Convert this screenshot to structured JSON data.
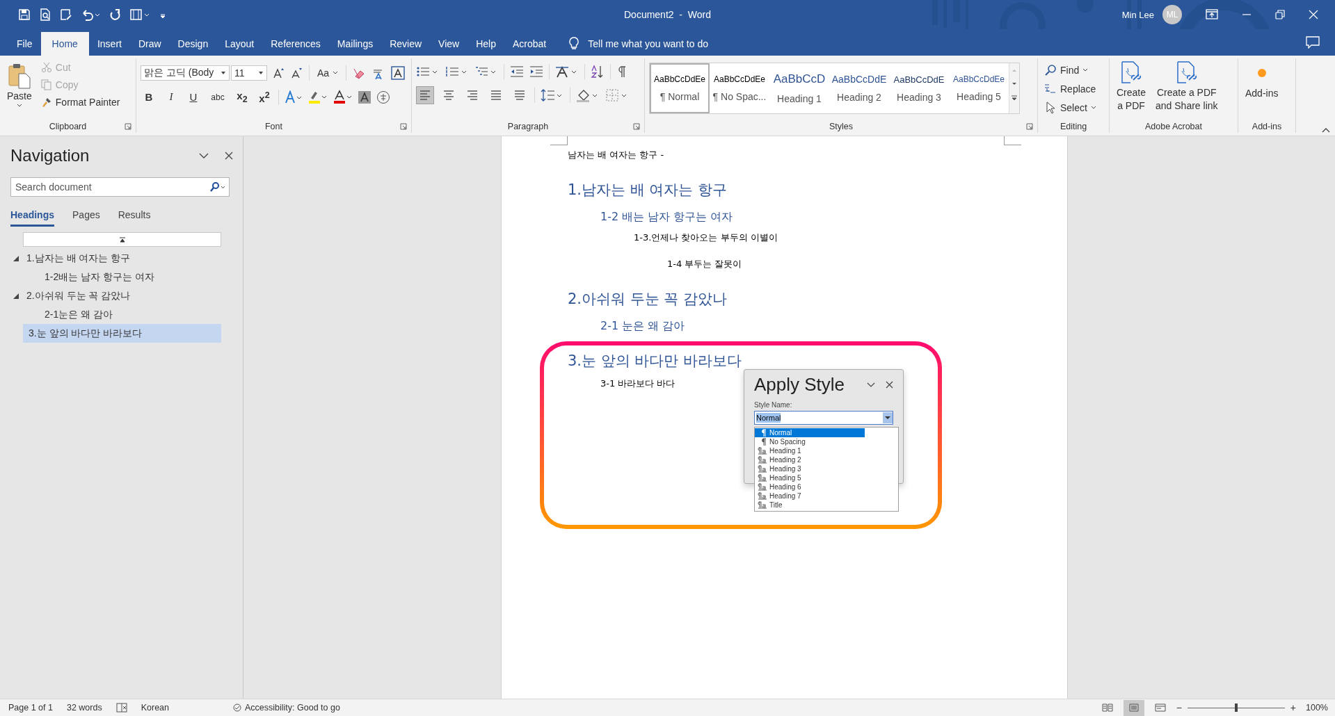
{
  "window": {
    "title": "Document2  -  Word",
    "user": "Min Lee",
    "avatar": "ML"
  },
  "tabs": [
    {
      "label": "File",
      "selected": false
    },
    {
      "label": "Home",
      "selected": true
    },
    {
      "label": "Insert",
      "selected": false
    },
    {
      "label": "Draw",
      "selected": false
    },
    {
      "label": "Design",
      "selected": false
    },
    {
      "label": "Layout",
      "selected": false
    },
    {
      "label": "References",
      "selected": false
    },
    {
      "label": "Mailings",
      "selected": false
    },
    {
      "label": "Review",
      "selected": false
    },
    {
      "label": "View",
      "selected": false
    },
    {
      "label": "Help",
      "selected": false
    },
    {
      "label": "Acrobat",
      "selected": false
    }
  ],
  "tell_me": {
    "placeholder": "Tell me what you want to do"
  },
  "ribbon": {
    "clipboard": {
      "label": "Clipboard",
      "paste": "Paste",
      "items": [
        {
          "label": "Cut",
          "kind": "cut",
          "disabled": true
        },
        {
          "label": "Copy",
          "kind": "copy",
          "disabled": true
        },
        {
          "label": "Format Painter",
          "kind": "format-painter",
          "disabled": false
        }
      ]
    },
    "font": {
      "label": "Font",
      "name": "맑은 고딕 (Body",
      "size": "11",
      "case": "Aa",
      "format_buttons": [
        {
          "text": "B",
          "kind": "bold"
        },
        {
          "text": "I",
          "kind": "italic"
        },
        {
          "text": "U",
          "kind": "underline"
        },
        {
          "text": "abc",
          "kind": "strike"
        },
        {
          "text": "x$_{2}$",
          "kind": "subscript"
        },
        {
          "text": "x$^{2}$",
          "kind": "superscript"
        }
      ]
    },
    "paragraph": {
      "label": "Paragraph",
      "align_buttons": [
        {
          "kind": "left",
          "selected": true
        },
        {
          "kind": "center",
          "selected": false
        },
        {
          "kind": "right",
          "selected": false
        },
        {
          "kind": "justify",
          "selected": false
        },
        {
          "kind": "distributed",
          "selected": false
        }
      ]
    },
    "styles": {
      "label": "Styles",
      "items": [
        {
          "sample": "AaBbCcDdEe",
          "label": "¶ Normal",
          "kind": "normal",
          "selected": true
        },
        {
          "sample": "AaBbCcDdEe",
          "label": "¶ No Spac...",
          "kind": "no-spacing",
          "selected": false
        },
        {
          "sample": "AaBbCcD",
          "label": "Heading 1",
          "kind": "heading-1",
          "selected": false
        },
        {
          "sample": "AaBbCcDdE",
          "label": "Heading 2",
          "kind": "heading-2",
          "selected": false
        },
        {
          "sample": "AaBbCcDdE",
          "label": "Heading 3",
          "kind": "heading-3",
          "selected": false
        },
        {
          "sample": "AaBbCcDdEe",
          "label": "Heading 5",
          "kind": "heading-5",
          "selected": false
        }
      ]
    },
    "editing": {
      "label": "Editing",
      "items": [
        {
          "label": "Find",
          "kind": "find"
        },
        {
          "label": "Replace",
          "kind": "replace"
        },
        {
          "label": "Select",
          "kind": "select"
        }
      ]
    },
    "acrobat": {
      "label": "Adobe Acrobat",
      "buttons": [
        {
          "lines": [
            "Create",
            "a PDF"
          ]
        },
        {
          "lines": [
            "Create a PDF",
            "and Share link"
          ]
        }
      ]
    },
    "addins": {
      "label": "Add-ins",
      "button": "Add-ins"
    }
  },
  "navigation": {
    "title": "Navigation",
    "search": {
      "placeholder": "Search document"
    },
    "tabs": [
      {
        "label": "Headings",
        "selected": true
      },
      {
        "label": "Pages",
        "selected": false
      },
      {
        "label": "Results",
        "selected": false
      }
    ],
    "headings": [
      {
        "label": "1.남자는 배 여자는 항구",
        "expanded": true,
        "selected": false,
        "children": [
          {
            "label": "1-2배는 남자 항구는 여자",
            "selected": false
          }
        ]
      },
      {
        "label": "2.아쉬워 두눈 꼭 감았나",
        "expanded": true,
        "selected": false,
        "children": [
          {
            "label": "2-1눈은 왜 감아",
            "selected": false
          }
        ]
      },
      {
        "label": "3.눈 앞의 바다만 바라보다",
        "selected": true
      }
    ]
  },
  "document": {
    "lines": [
      {
        "text": "남자는 배 여자는 항구 -",
        "kind": "plain"
      },
      {
        "text": "1.남자는 배 여자는 항구",
        "kind": "heading-1"
      },
      {
        "text": "1-2 배는 남자 항구는 여자",
        "kind": "heading-2"
      },
      {
        "text": "1-3.언제나 찾아오는 부두의 이별이",
        "kind": "indent-3"
      },
      {
        "text": "1-4 부두는 잘못이",
        "kind": "indent-4"
      },
      {
        "text": "2.아쉬워 두눈 꼭 감았나",
        "kind": "heading-1"
      },
      {
        "text": "2-1 눈은 왜 감아",
        "kind": "heading-2"
      },
      {
        "text": "3.눈 앞의 바다만 바라보다",
        "kind": "heading-1"
      },
      {
        "text": "3-1 바라보다 바다",
        "kind": "indent-2"
      }
    ]
  },
  "apply_styles": {
    "title": "Apply Style",
    "label": "Style Name:",
    "value": "Normal",
    "options": [
      {
        "label": "Normal",
        "kind": "paragraph",
        "selected": true
      },
      {
        "label": "No Spacing",
        "kind": "paragraph",
        "selected": false
      },
      {
        "label": "Heading 1",
        "kind": "linked",
        "selected": false
      },
      {
        "label": "Heading 2",
        "kind": "linked",
        "selected": false
      },
      {
        "label": "Heading 3",
        "kind": "linked",
        "selected": false
      },
      {
        "label": "Heading 5",
        "kind": "linked",
        "selected": false
      },
      {
        "label": "Heading 6",
        "kind": "linked",
        "selected": false
      },
      {
        "label": "Heading 7",
        "kind": "linked",
        "selected": false
      },
      {
        "label": "Title",
        "kind": "linked",
        "selected": false
      }
    ]
  },
  "status_bar": {
    "page": "Page 1 of 1",
    "words": "32 words",
    "language": "Korean",
    "accessibility": "Accessibility: Good to go",
    "views": [
      {
        "kind": "read",
        "selected": false
      },
      {
        "kind": "print",
        "selected": true
      },
      {
        "kind": "web",
        "selected": false
      }
    ],
    "zoom_out": "−",
    "zoom_slider": {
      "level": 0.5
    },
    "zoom_in": "+",
    "zoom": "100%"
  }
}
